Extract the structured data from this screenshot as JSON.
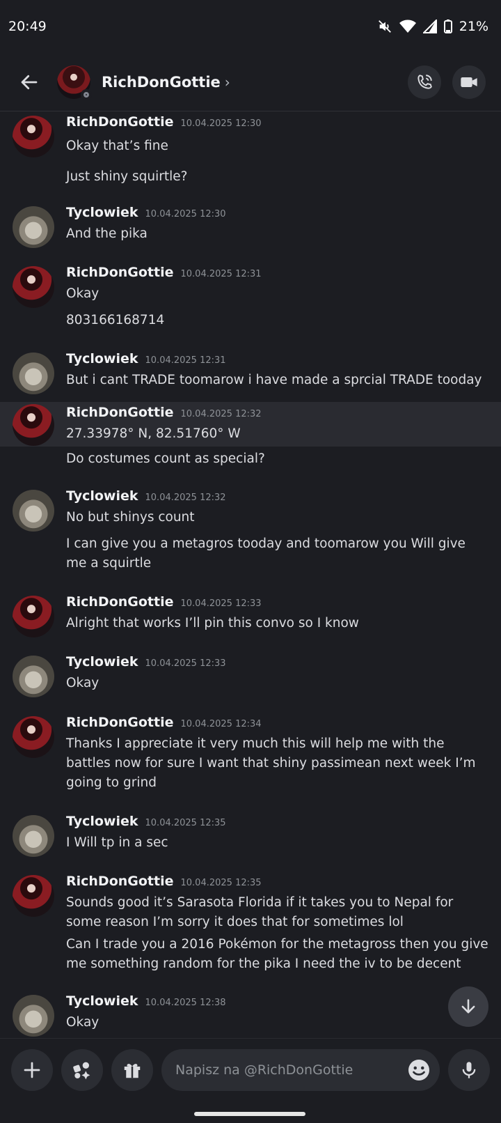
{
  "status_bar": {
    "time": "20:49",
    "battery": "21%"
  },
  "header": {
    "contact_name": "RichDonGottie"
  },
  "messages": [
    {
      "author": "RichDonGottie",
      "avatar": "rich",
      "timestamp": "10.04.2025 12:30",
      "lines": [
        "Okay that’s fine",
        "Just shiny squirtle?"
      ]
    },
    {
      "author": "Tyclowiek",
      "avatar": "tyc",
      "timestamp": "10.04.2025 12:30",
      "lines": [
        "And the pika"
      ]
    },
    {
      "author": "RichDonGottie",
      "avatar": "rich",
      "timestamp": "10.04.2025 12:31",
      "lines": [
        "Okay",
        "803166168714"
      ]
    },
    {
      "author": "Tyclowiek",
      "avatar": "tyc",
      "timestamp": "10.04.2025 12:31",
      "lines": [
        "But i cant TRADE toomarow i have made a sprcial TRADE tooday"
      ]
    },
    {
      "author": "RichDonGottie",
      "avatar": "rich",
      "timestamp": "10.04.2025 12:32",
      "highlight": true,
      "lines": [
        "27.33978° N, 82.51760° W",
        "Do costumes count as special?"
      ]
    },
    {
      "author": "Tyclowiek",
      "avatar": "tyc",
      "timestamp": "10.04.2025 12:32",
      "lines": [
        "No but shinys count",
        "I can give you a metagros tooday and toomarow you Will give me a squirtle"
      ]
    },
    {
      "author": "RichDonGottie",
      "avatar": "rich",
      "timestamp": "10.04.2025 12:33",
      "lines": [
        "Alright that works I’ll pin this convo so I know"
      ]
    },
    {
      "author": "Tyclowiek",
      "avatar": "tyc",
      "timestamp": "10.04.2025 12:33",
      "lines": [
        "Okay"
      ]
    },
    {
      "author": "RichDonGottie",
      "avatar": "rich",
      "timestamp": "10.04.2025 12:34",
      "lines": [
        "Thanks I appreciate it very much this will help me with the battles now for sure I want that shiny passimean next week I’m going to grind"
      ]
    },
    {
      "author": "Tyclowiek",
      "avatar": "tyc",
      "timestamp": "10.04.2025 12:35",
      "lines": [
        "I Will tp in a sec"
      ]
    },
    {
      "author": "RichDonGottie",
      "avatar": "rich",
      "timestamp": "10.04.2025 12:35",
      "lines": [
        "Sounds good it’s Sarasota Florida if it takes you to Nepal for some reason I’m sorry it does that for sometimes lol",
        "Can I trade you a 2016 Pokémon for the metagross then you give me something random for the pika I need the iv to be decent"
      ]
    },
    {
      "author": "Tyclowiek",
      "avatar": "tyc",
      "timestamp": "10.04.2025 12:38",
      "lines": [
        "Okay"
      ]
    }
  ],
  "composer": {
    "placeholder": "Napisz na @RichDonGottie"
  },
  "icons": {
    "back": "arrow-left-icon",
    "call": "phone-call-icon",
    "video": "video-camera-icon",
    "jump": "arrow-down-icon",
    "add": "plus-icon",
    "apps": "apps-icon",
    "gift": "gift-icon",
    "emoji": "emoji-icon",
    "mic": "microphone-icon"
  }
}
